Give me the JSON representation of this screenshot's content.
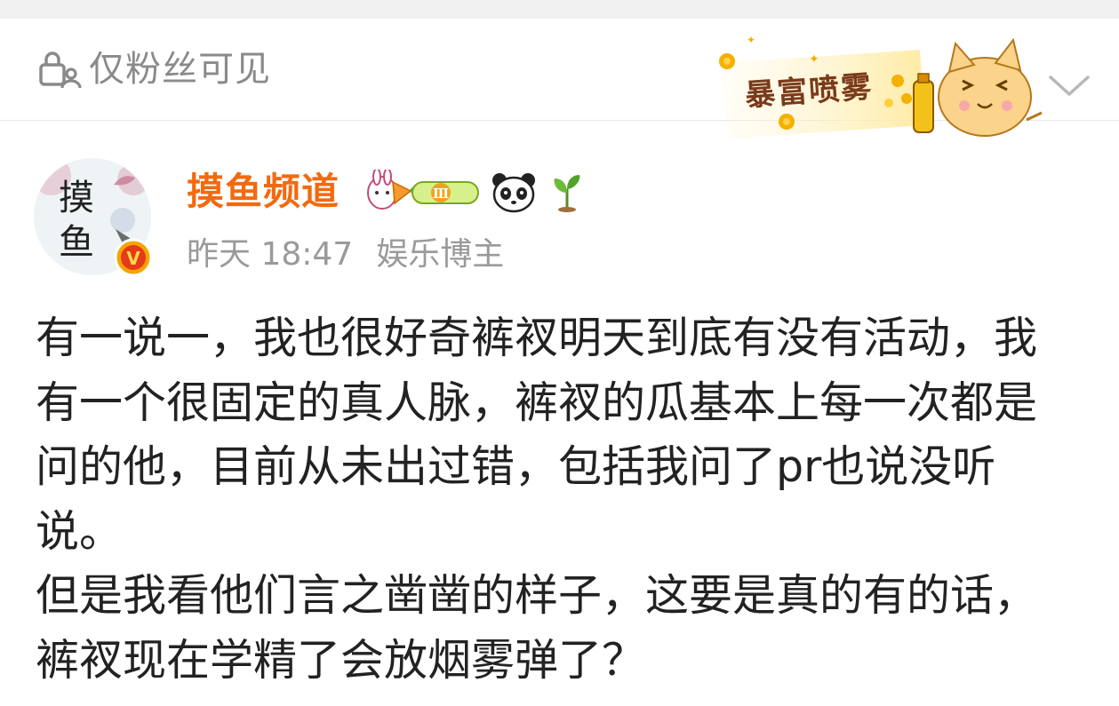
{
  "visibility": {
    "icon": "lock-person-icon",
    "text": "仅粉丝可见"
  },
  "banner": {
    "text": "暴富喷雾",
    "icon": "cat-spray-banner"
  },
  "dropdown": {
    "icon": "chevron-down-icon"
  },
  "post": {
    "author": {
      "name": "摸鱼频道",
      "avatar_text": "摸鱼",
      "verified_badge": "V",
      "level_badge": "Ⅲ",
      "icons": [
        "rabbit-carrot-badge",
        "level-badge",
        "panda-icon",
        "sprout-icon"
      ]
    },
    "time": "昨天 18:47",
    "role": "娱乐博主",
    "content": "有一说一，我也很好奇裤衩明天到底有没有活动，我有一个很固定的真人脉，裤衩的瓜基本上每一次都是问的他，目前从未出过错，包括我问了pr也说没听说。\n但是我看他们言之凿凿的样子，这要是真的有的话，裤衩现在学精了会放烟雾弹了？"
  },
  "colors": {
    "username": "#f26a10",
    "meta": "#9a9a9a",
    "content": "#222222",
    "verified": "#f5a400"
  }
}
